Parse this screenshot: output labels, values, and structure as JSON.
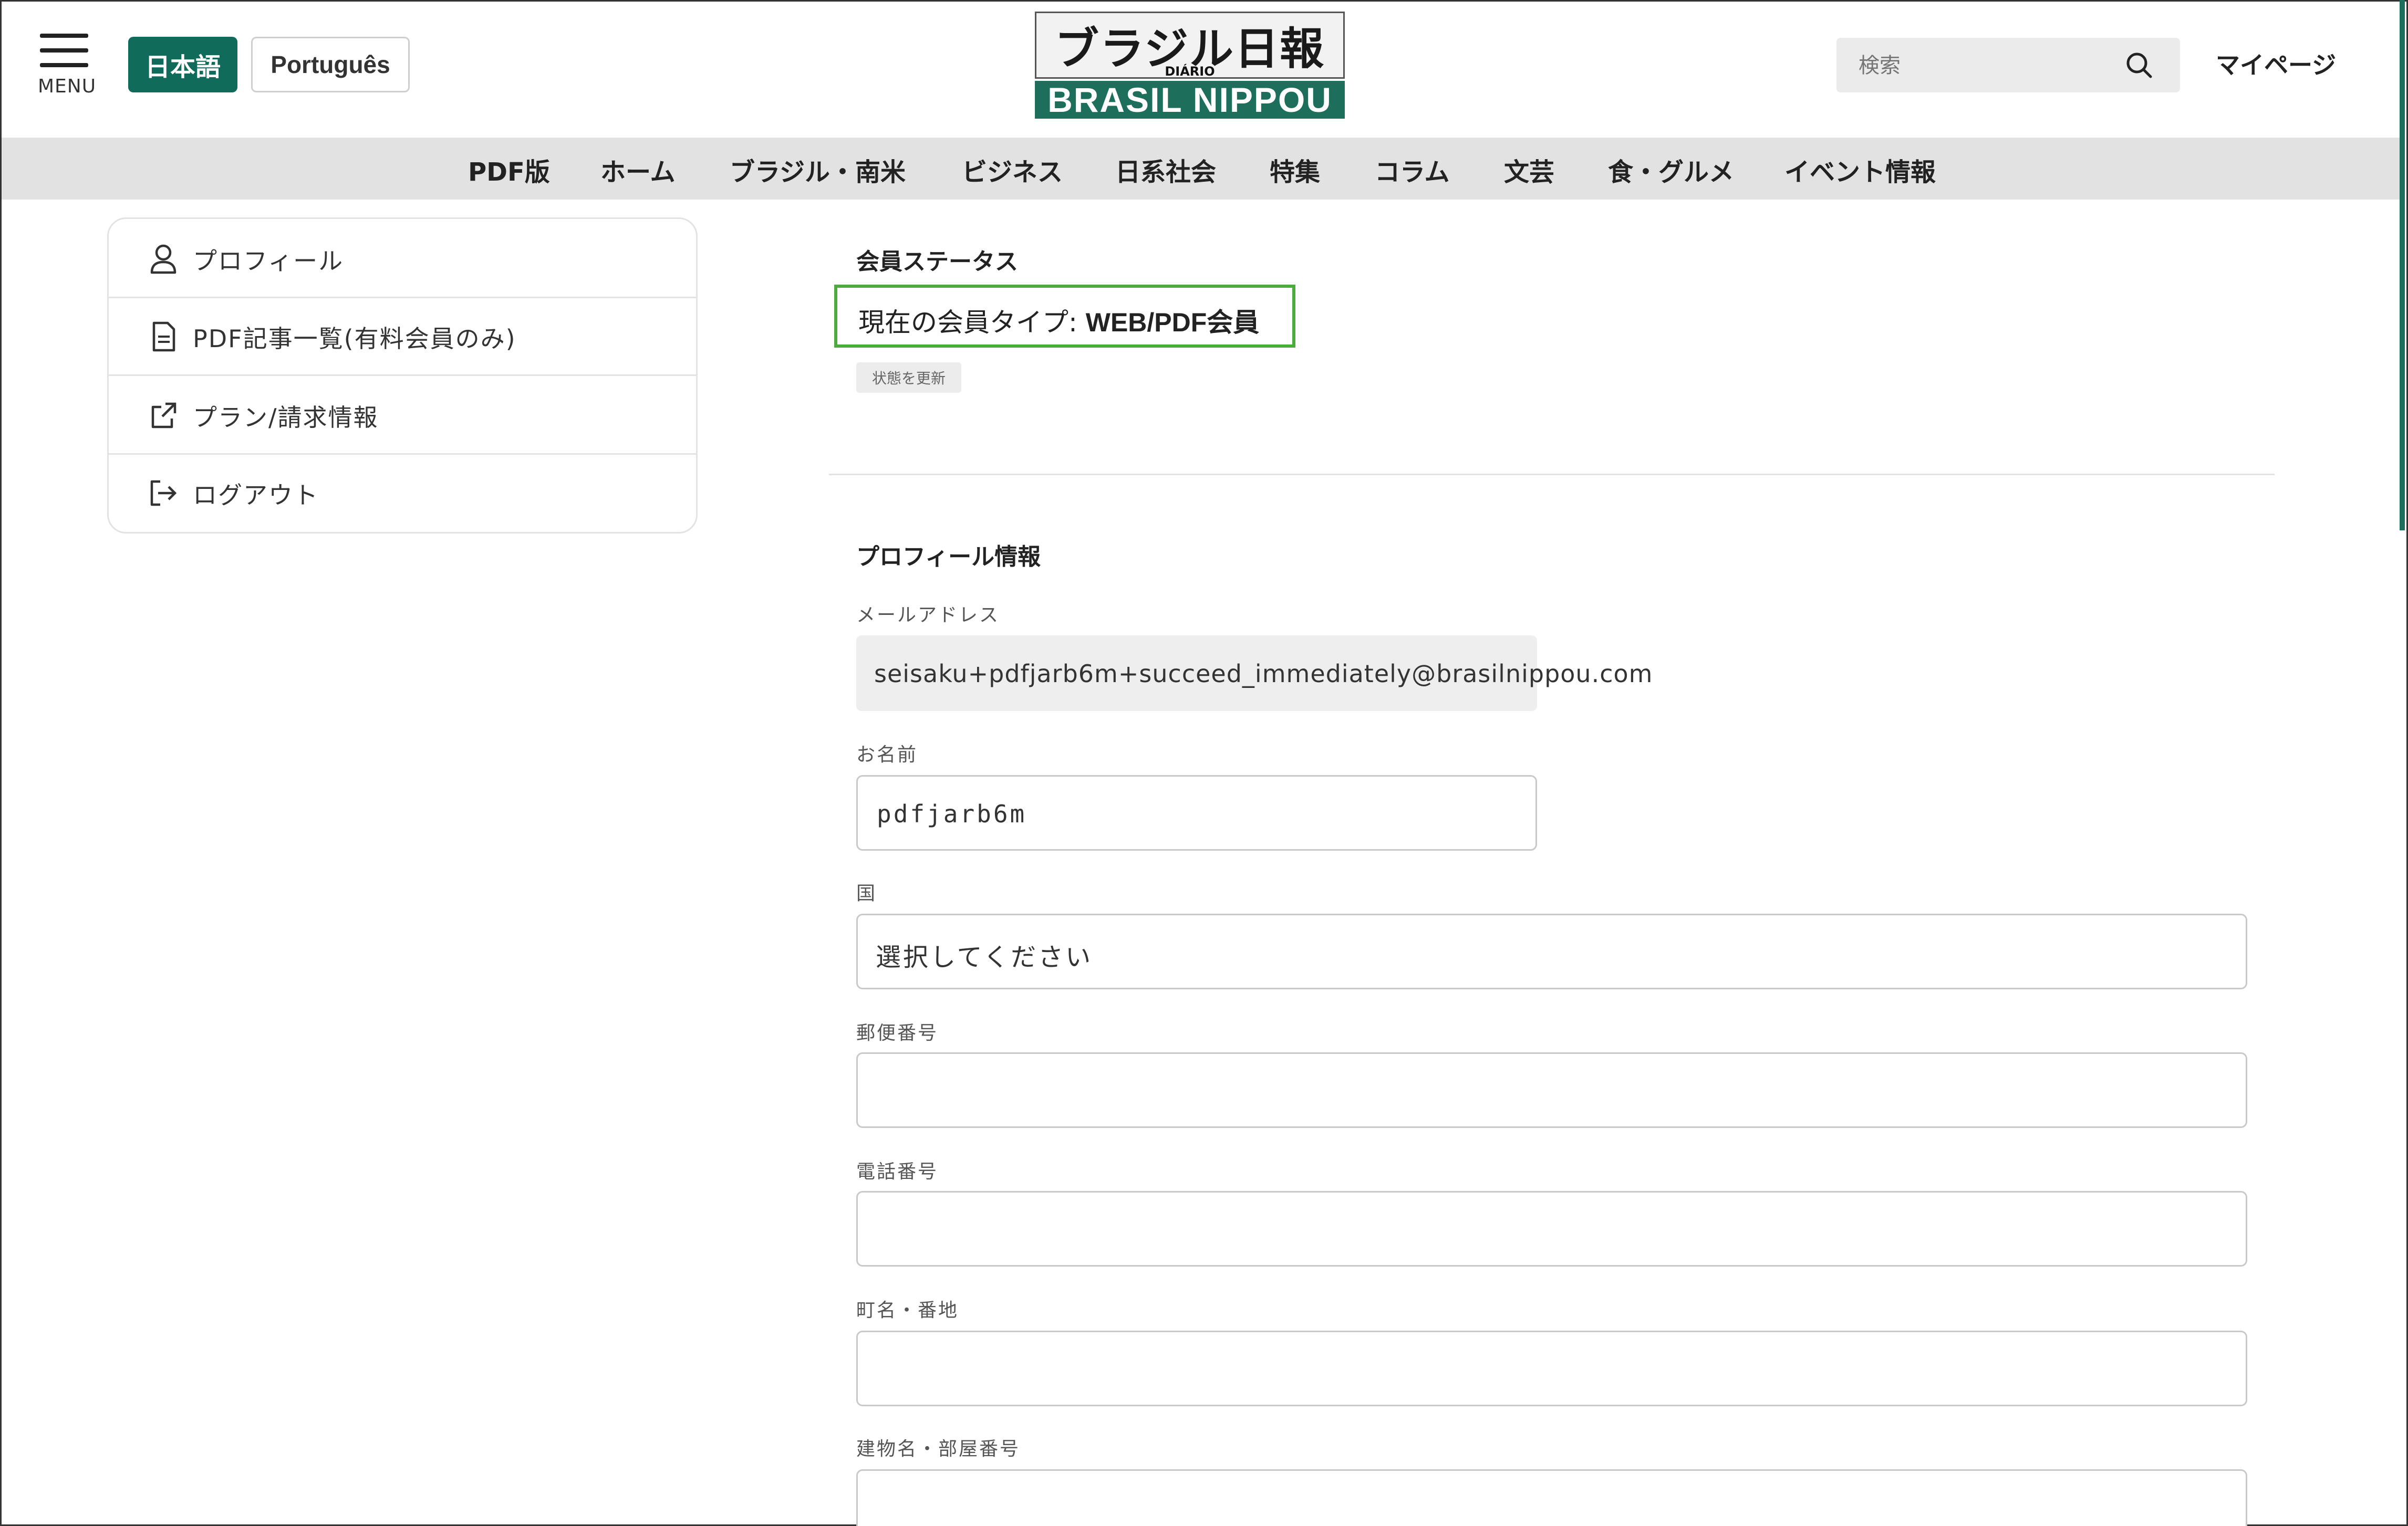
{
  "header": {
    "menu_label": "MENU",
    "lang_ja": "日本語",
    "lang_pt": "Português",
    "logo_top": "ブラジル日報",
    "logo_small": "DIÁRIO",
    "logo_bottom": "BRASIL NIPPOU",
    "search_placeholder": "検索",
    "mypage": "マイページ"
  },
  "nav": {
    "items": [
      "PDF版",
      "ホーム",
      "ブラジル・南米",
      "ビジネス",
      "日系社会",
      "特集",
      "コラム",
      "文芸",
      "食・グルメ",
      "イベント情報"
    ]
  },
  "sidebar": {
    "items": [
      {
        "label": "プロフィール",
        "icon": "user-icon"
      },
      {
        "label": "PDF記事一覧(有料会員のみ)",
        "icon": "document-icon"
      },
      {
        "label": "プラン/請求情報",
        "icon": "external-link-icon"
      },
      {
        "label": "ログアウト",
        "icon": "logout-icon"
      }
    ]
  },
  "status": {
    "heading": "会員ステータス",
    "type_label": "現在の会員タイプ: ",
    "type_value": "WEB/PDF会員",
    "refresh_button": "状態を更新"
  },
  "profile": {
    "heading": "プロフィール情報",
    "email_label": "メールアドレス",
    "email_value": "seisaku+pdfjarb6m+succeed_immediately@brasilnippou.com",
    "name_label": "お名前",
    "name_value": "pdfjarb6m",
    "country_label": "国",
    "country_value": "選択してください",
    "postal_label": "郵便番号",
    "postal_value": "",
    "phone_label": "電話番号",
    "phone_value": "",
    "address_label": "町名・番地",
    "address_value": "",
    "building_label": "建物名・部屋番号",
    "building_value": ""
  },
  "colors": {
    "brand_green": "#116b5b",
    "status_border": "#4caa3e",
    "nav_bg": "#e2e2e2"
  }
}
